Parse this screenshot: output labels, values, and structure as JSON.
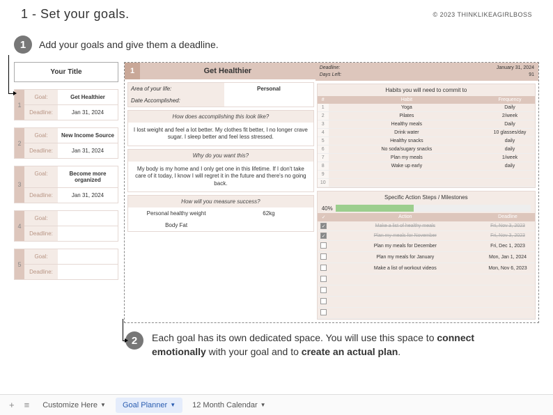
{
  "header": {
    "title": "1 - Set your goals.",
    "copyright": "© 2023 THINKLIKEAGIRLBOSS"
  },
  "step1": {
    "num": "1",
    "text": "Add your goals and give them a deadline."
  },
  "title_box": "Your Title",
  "goal_labels": {
    "goal": "Goal:",
    "deadline": "Deadline:"
  },
  "goals": [
    {
      "n": "1",
      "title": "Get Healthier",
      "deadline": "Jan 31, 2024"
    },
    {
      "n": "2",
      "title": "New Income Source",
      "deadline": "Jan 31, 2024"
    },
    {
      "n": "3",
      "title": "Become more organized",
      "deadline": "Jan 31, 2024"
    },
    {
      "n": "4",
      "title": "",
      "deadline": ""
    },
    {
      "n": "5",
      "title": "",
      "deadline": ""
    }
  ],
  "detail": {
    "num": "1",
    "title": "Get Healthier",
    "deadline_label": "Deadline:",
    "deadline": "January 31, 2024",
    "daysleft_label": "Days Left:",
    "daysleft": "91",
    "area_label": "Area of your life:",
    "area": "Personal",
    "date_acc_label": "Date Accomplished:",
    "date_acc": "",
    "q1": "How does accomplishing this look like?",
    "a1": "I lost weight and feel a lot better. My clothes fit better, I no longer crave sugar. I sleep better and feel less stressed.",
    "q2": "Why do you want this?",
    "a2": "My body is my home and I only get one in this lifetime. If I don't take care of it today, I know I will regret it in the future and there's no going back.",
    "q3": "How will you measure success?",
    "m1_label": "Personal healthy weight",
    "m1_val": "62kg",
    "m2_label": "Body Fat",
    "m2_val": ""
  },
  "habits": {
    "header": "Habits you will need to commit to",
    "cols": {
      "n": "#",
      "habit": "Habit",
      "freq": "Frequency"
    },
    "rows": [
      {
        "n": "1",
        "habit": "Yoga",
        "freq": "Daily"
      },
      {
        "n": "2",
        "habit": "Pilates",
        "freq": "2/week"
      },
      {
        "n": "3",
        "habit": "Healthy meals",
        "freq": "Daily"
      },
      {
        "n": "4",
        "habit": "Drink water",
        "freq": "10 glasses/day"
      },
      {
        "n": "5",
        "habit": "Healthy snacks",
        "freq": "daily"
      },
      {
        "n": "6",
        "habit": "No soda/sugary snacks",
        "freq": "daily"
      },
      {
        "n": "7",
        "habit": "Plan my meals",
        "freq": "1/week"
      },
      {
        "n": "8",
        "habit": "Wake up early",
        "freq": "daily"
      },
      {
        "n": "9",
        "habit": "",
        "freq": ""
      },
      {
        "n": "10",
        "habit": "",
        "freq": ""
      }
    ]
  },
  "actions": {
    "header": "Specific Action Steps / Milestones",
    "progress_pct": "40%",
    "progress_val": 40,
    "cols": {
      "chk": "✓",
      "action": "Action",
      "deadline": "Deadline"
    },
    "rows": [
      {
        "done": true,
        "action": "Make a list of healthy meals",
        "deadline": "Fri, Nov 3, 2023"
      },
      {
        "done": true,
        "action": "Plan my meals for November",
        "deadline": "Fri, Nov 3, 2023"
      },
      {
        "done": false,
        "action": "Plan my meals for December",
        "deadline": "Fri, Dec 1, 2023"
      },
      {
        "done": false,
        "action": "Plan my meals for January",
        "deadline": "Mon, Jan 1, 2024"
      },
      {
        "done": false,
        "action": "Make a list of workout videos",
        "deadline": "Mon, Nov 6, 2023"
      },
      {
        "done": false,
        "action": "",
        "deadline": ""
      },
      {
        "done": false,
        "action": "",
        "deadline": ""
      },
      {
        "done": false,
        "action": "",
        "deadline": ""
      },
      {
        "done": false,
        "action": "",
        "deadline": ""
      }
    ]
  },
  "step2": {
    "num": "2",
    "text_a": "Each goal has its own dedicated space. You will use this space to ",
    "text_b": "connect emotionally",
    "text_c": " with your goal and to ",
    "text_d": "create an actual plan",
    "text_e": "."
  },
  "tabs": {
    "t1": "Customize Here",
    "t2": "Goal Planner",
    "t3": "12 Month Calendar"
  }
}
